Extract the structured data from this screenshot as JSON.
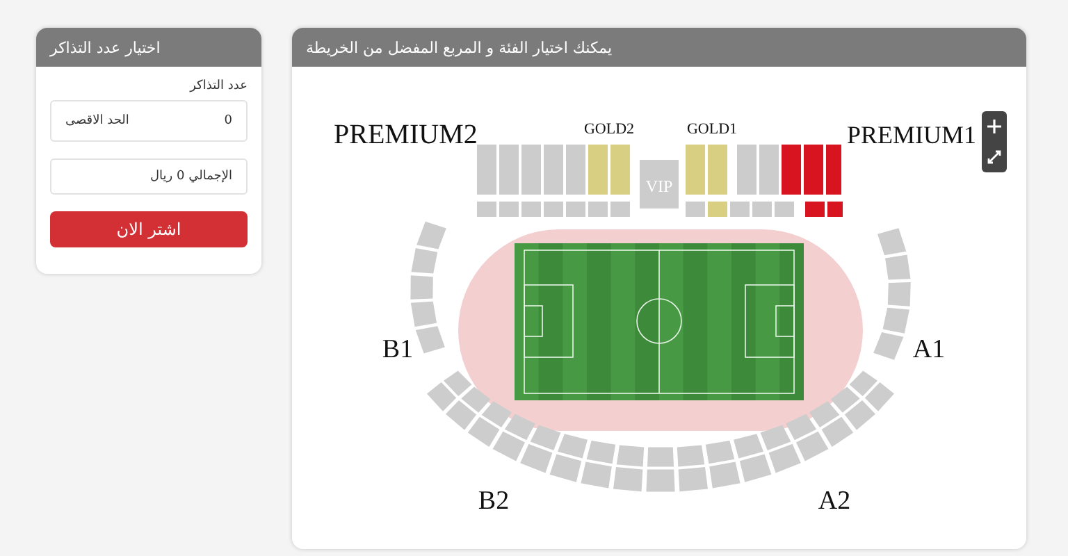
{
  "ticket_panel": {
    "title": "اختيار عدد التذاكر",
    "quantity_label": "عدد التذاكر",
    "quantity_value": "0",
    "max_label": "الحد الاقصى",
    "total": "الإجمالي 0 ريال",
    "buy_button": "اشتر الان"
  },
  "map_panel": {
    "title": "يمكنك اختيار الفئة و المربع المفضل من الخريطة",
    "zones": [
      {
        "name": "PREMIUM1"
      },
      {
        "name": "GOLD1"
      },
      {
        "name": "GOLD2"
      },
      {
        "name": "PREMIUM2"
      },
      {
        "name": "A1"
      },
      {
        "name": "B1"
      },
      {
        "name": "A2"
      },
      {
        "name": "B2"
      }
    ],
    "vip": "VIP",
    "upper_sections": [
      {
        "color": "#cccccc"
      },
      {
        "color": "#cccccc"
      },
      {
        "color": "#cccccc"
      },
      {
        "color": "#cccccc"
      },
      {
        "color": "#cccccc"
      },
      {
        "color": "#d8cf82"
      },
      {
        "color": "#d8cf82"
      },
      {
        "color": "#d8cf82"
      },
      {
        "color": "#d8cf82"
      },
      {
        "color": "#cccccc"
      },
      {
        "color": "#cccccc"
      },
      {
        "color": "#d7141f"
      },
      {
        "color": "#d7141f"
      },
      {
        "color": "#d7141f"
      }
    ],
    "lower_sections": [
      {
        "color": "#cccccc"
      },
      {
        "color": "#cccccc"
      },
      {
        "color": "#cccccc"
      },
      {
        "color": "#cccccc"
      },
      {
        "color": "#cccccc"
      },
      {
        "color": "#cccccc"
      },
      {
        "color": "#cccccc"
      },
      {
        "color": "#cccccc"
      },
      {
        "color": "#d8cf82"
      },
      {
        "color": "#cccccc"
      },
      {
        "color": "#cccccc"
      },
      {
        "color": "#cccccc"
      },
      {
        "color": "#d7141f"
      },
      {
        "color": "#d7141f"
      }
    ]
  }
}
